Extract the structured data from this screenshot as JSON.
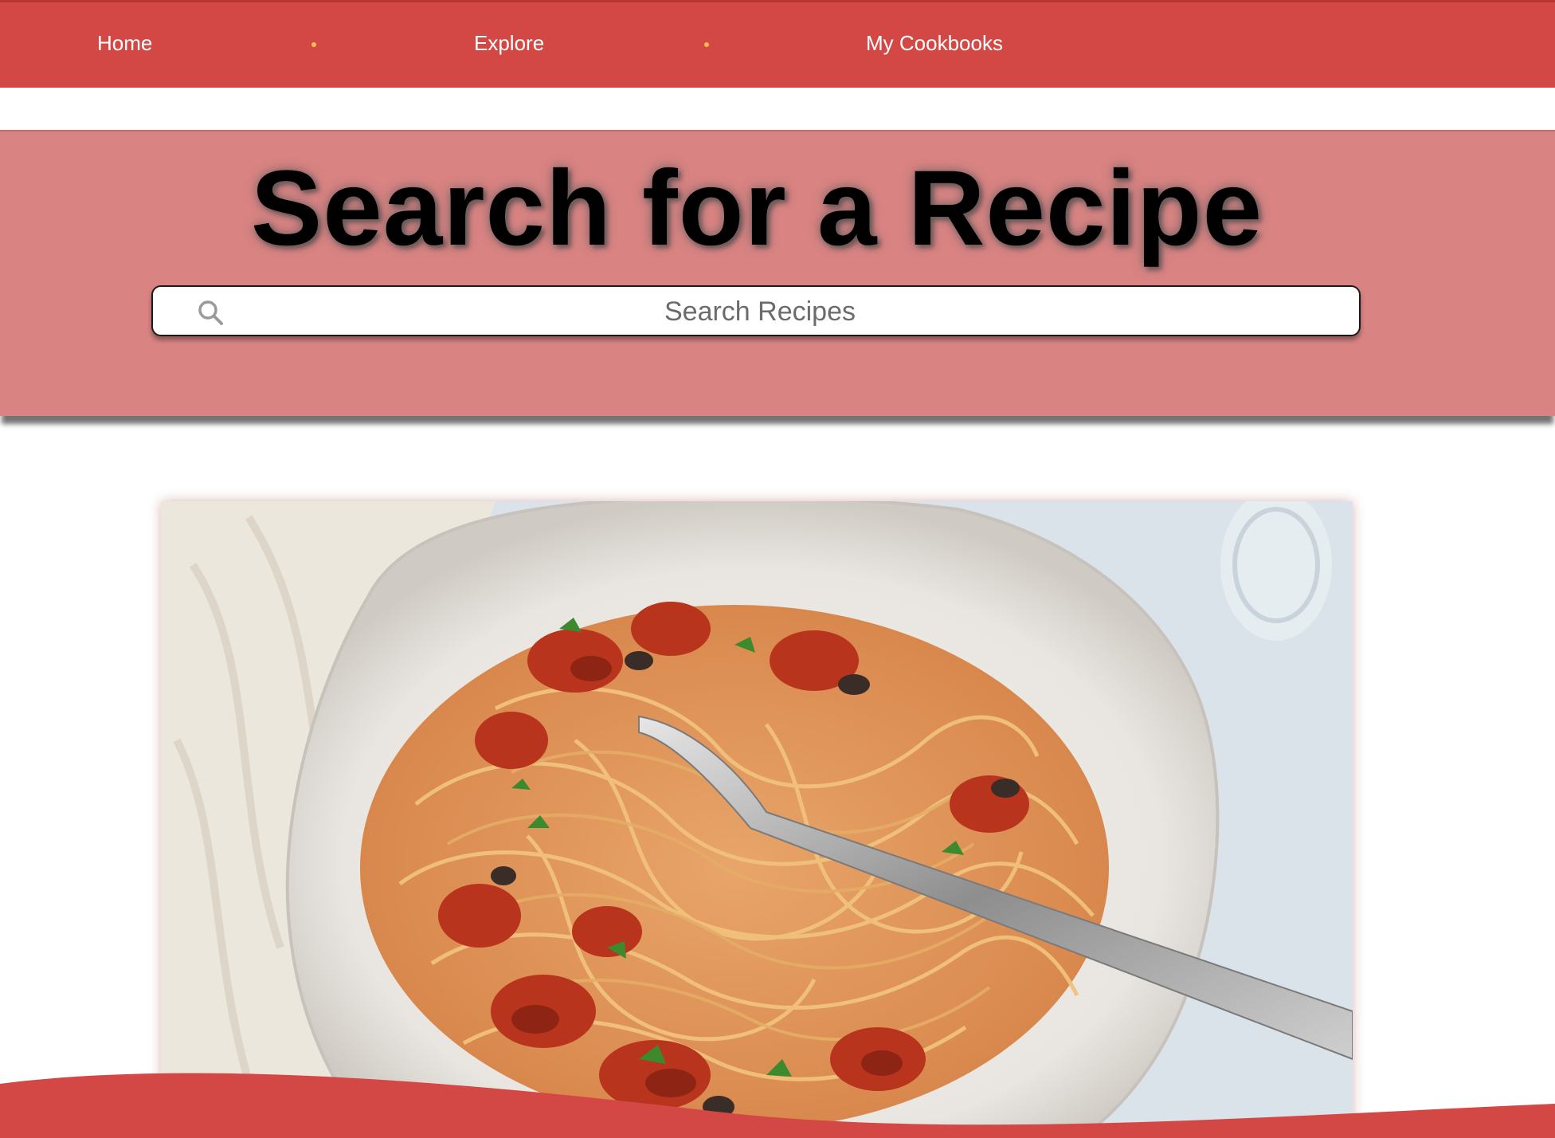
{
  "nav": {
    "items": [
      {
        "label": "Home"
      },
      {
        "label": "Explore"
      },
      {
        "label": "My Cookbooks"
      }
    ]
  },
  "hero": {
    "title": "Search for a Recipe",
    "search": {
      "placeholder": "Search Recipes",
      "value": ""
    }
  },
  "feature": {
    "image_alt": "Spaghetti with tomato sauce on a white plate"
  },
  "colors": {
    "nav_bg": "#d34844",
    "hero_bg": "#d98483",
    "nav_dot": "#f2c14e"
  },
  "icons": {
    "search": "search-icon"
  }
}
